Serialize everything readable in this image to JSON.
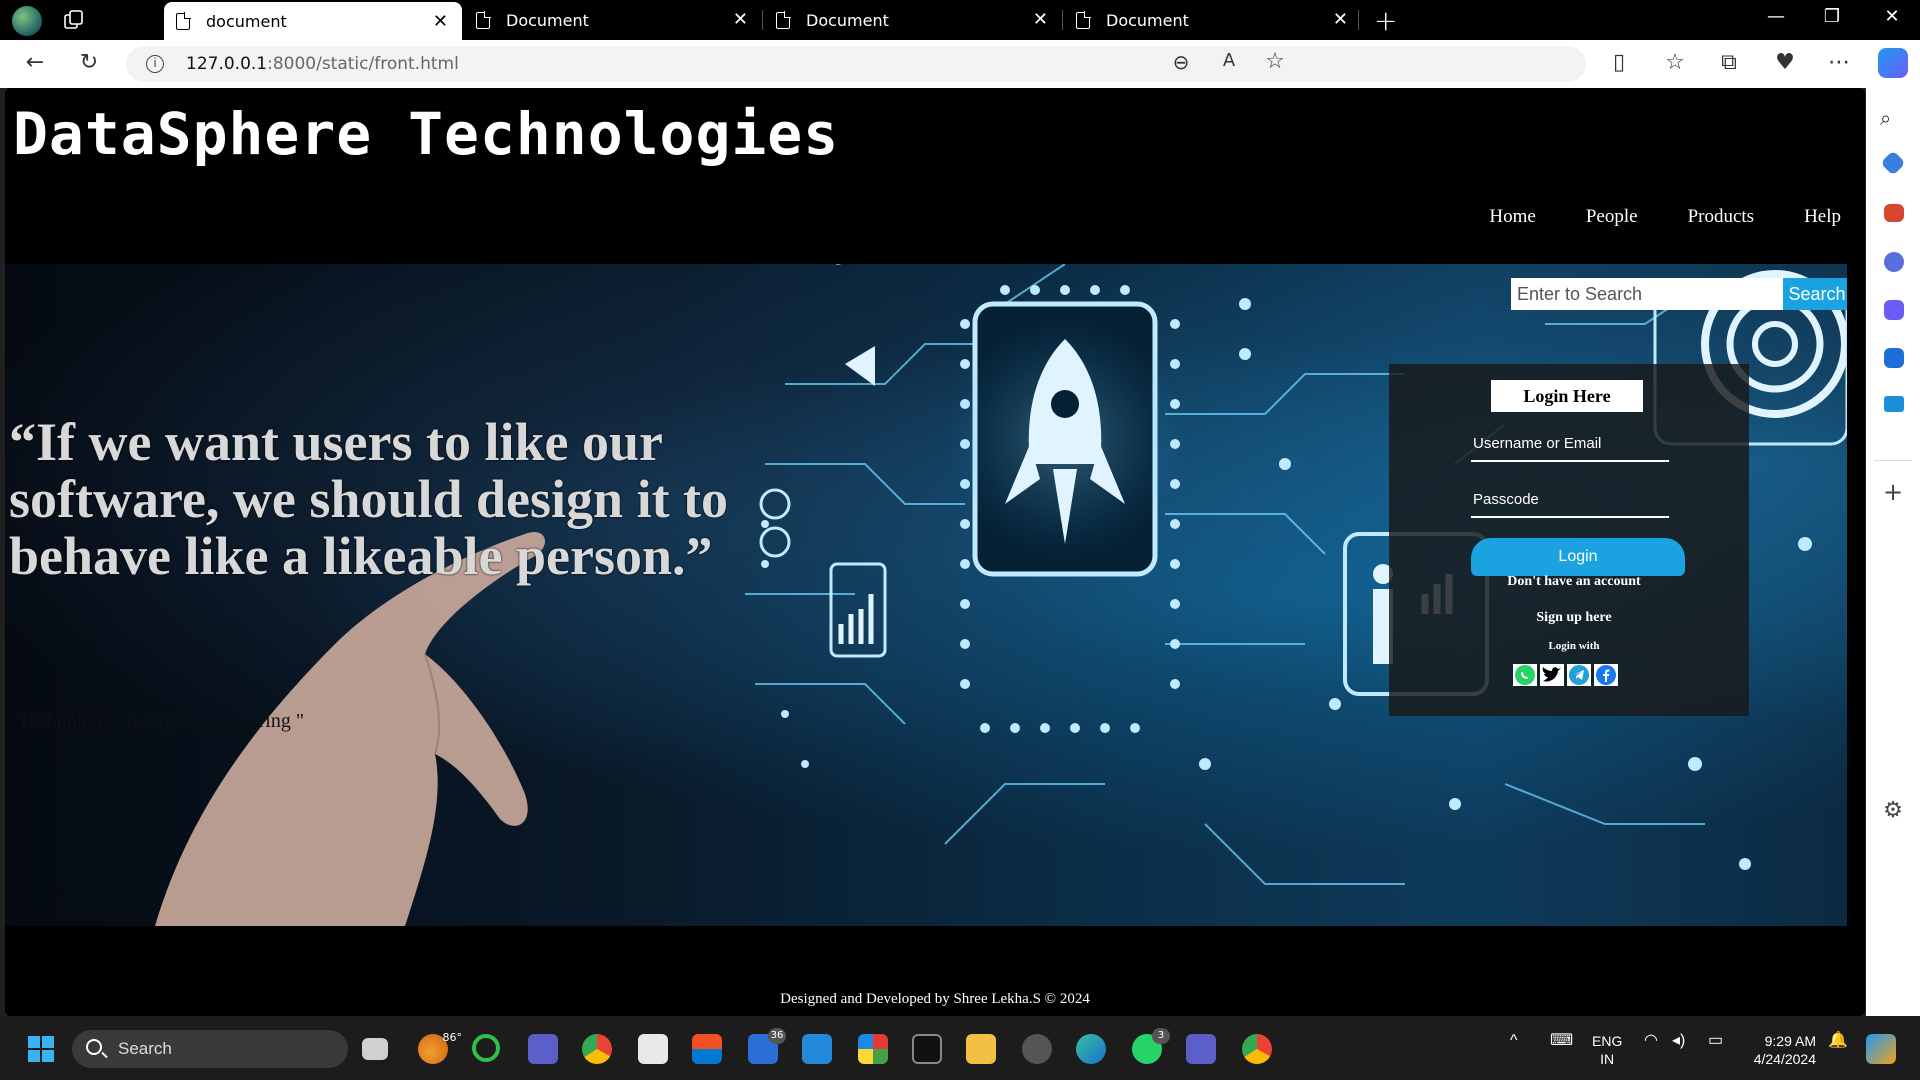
{
  "browser": {
    "tabs": [
      {
        "title": "document",
        "active": true
      },
      {
        "title": "Document",
        "active": false
      },
      {
        "title": "Document",
        "active": false
      },
      {
        "title": "Document",
        "active": false
      }
    ],
    "url_host": "127.0.0.1",
    "url_rest": ":8000/static/front.html"
  },
  "site": {
    "brand": "DataSphere Technologies",
    "nav": [
      "Home",
      "People",
      "Products",
      "Help"
    ],
    "quote": "“If we want users to like our software, we should design it to behave like a likeable person.”",
    "tagline": "\"Technology | Analyst |engineering \"",
    "search": {
      "placeholder": "Enter to Search",
      "button": "Search"
    },
    "login": {
      "title": "Login Here",
      "username_placeholder": "Username or Email",
      "password_placeholder": "Passcode",
      "button": "Login",
      "no_account": "Don't have an account",
      "signup": "Sign up here",
      "login_with": "Login with",
      "socials": [
        "whatsapp-icon",
        "twitter-icon",
        "telegram-icon",
        "facebook-icon"
      ]
    },
    "footer": "Designed and Developed by Shree Lekha.S © 2024"
  },
  "taskbar": {
    "search": "Search",
    "weather_temp": "86°",
    "lang_top": "ENG",
    "lang_bottom": "IN",
    "time": "9:29 AM",
    "date": "4/24/2024",
    "badge_mail": "36",
    "badge_whatsapp": "3"
  },
  "colors": {
    "accent": "#1aa3e0",
    "page_bg": "#000000"
  }
}
